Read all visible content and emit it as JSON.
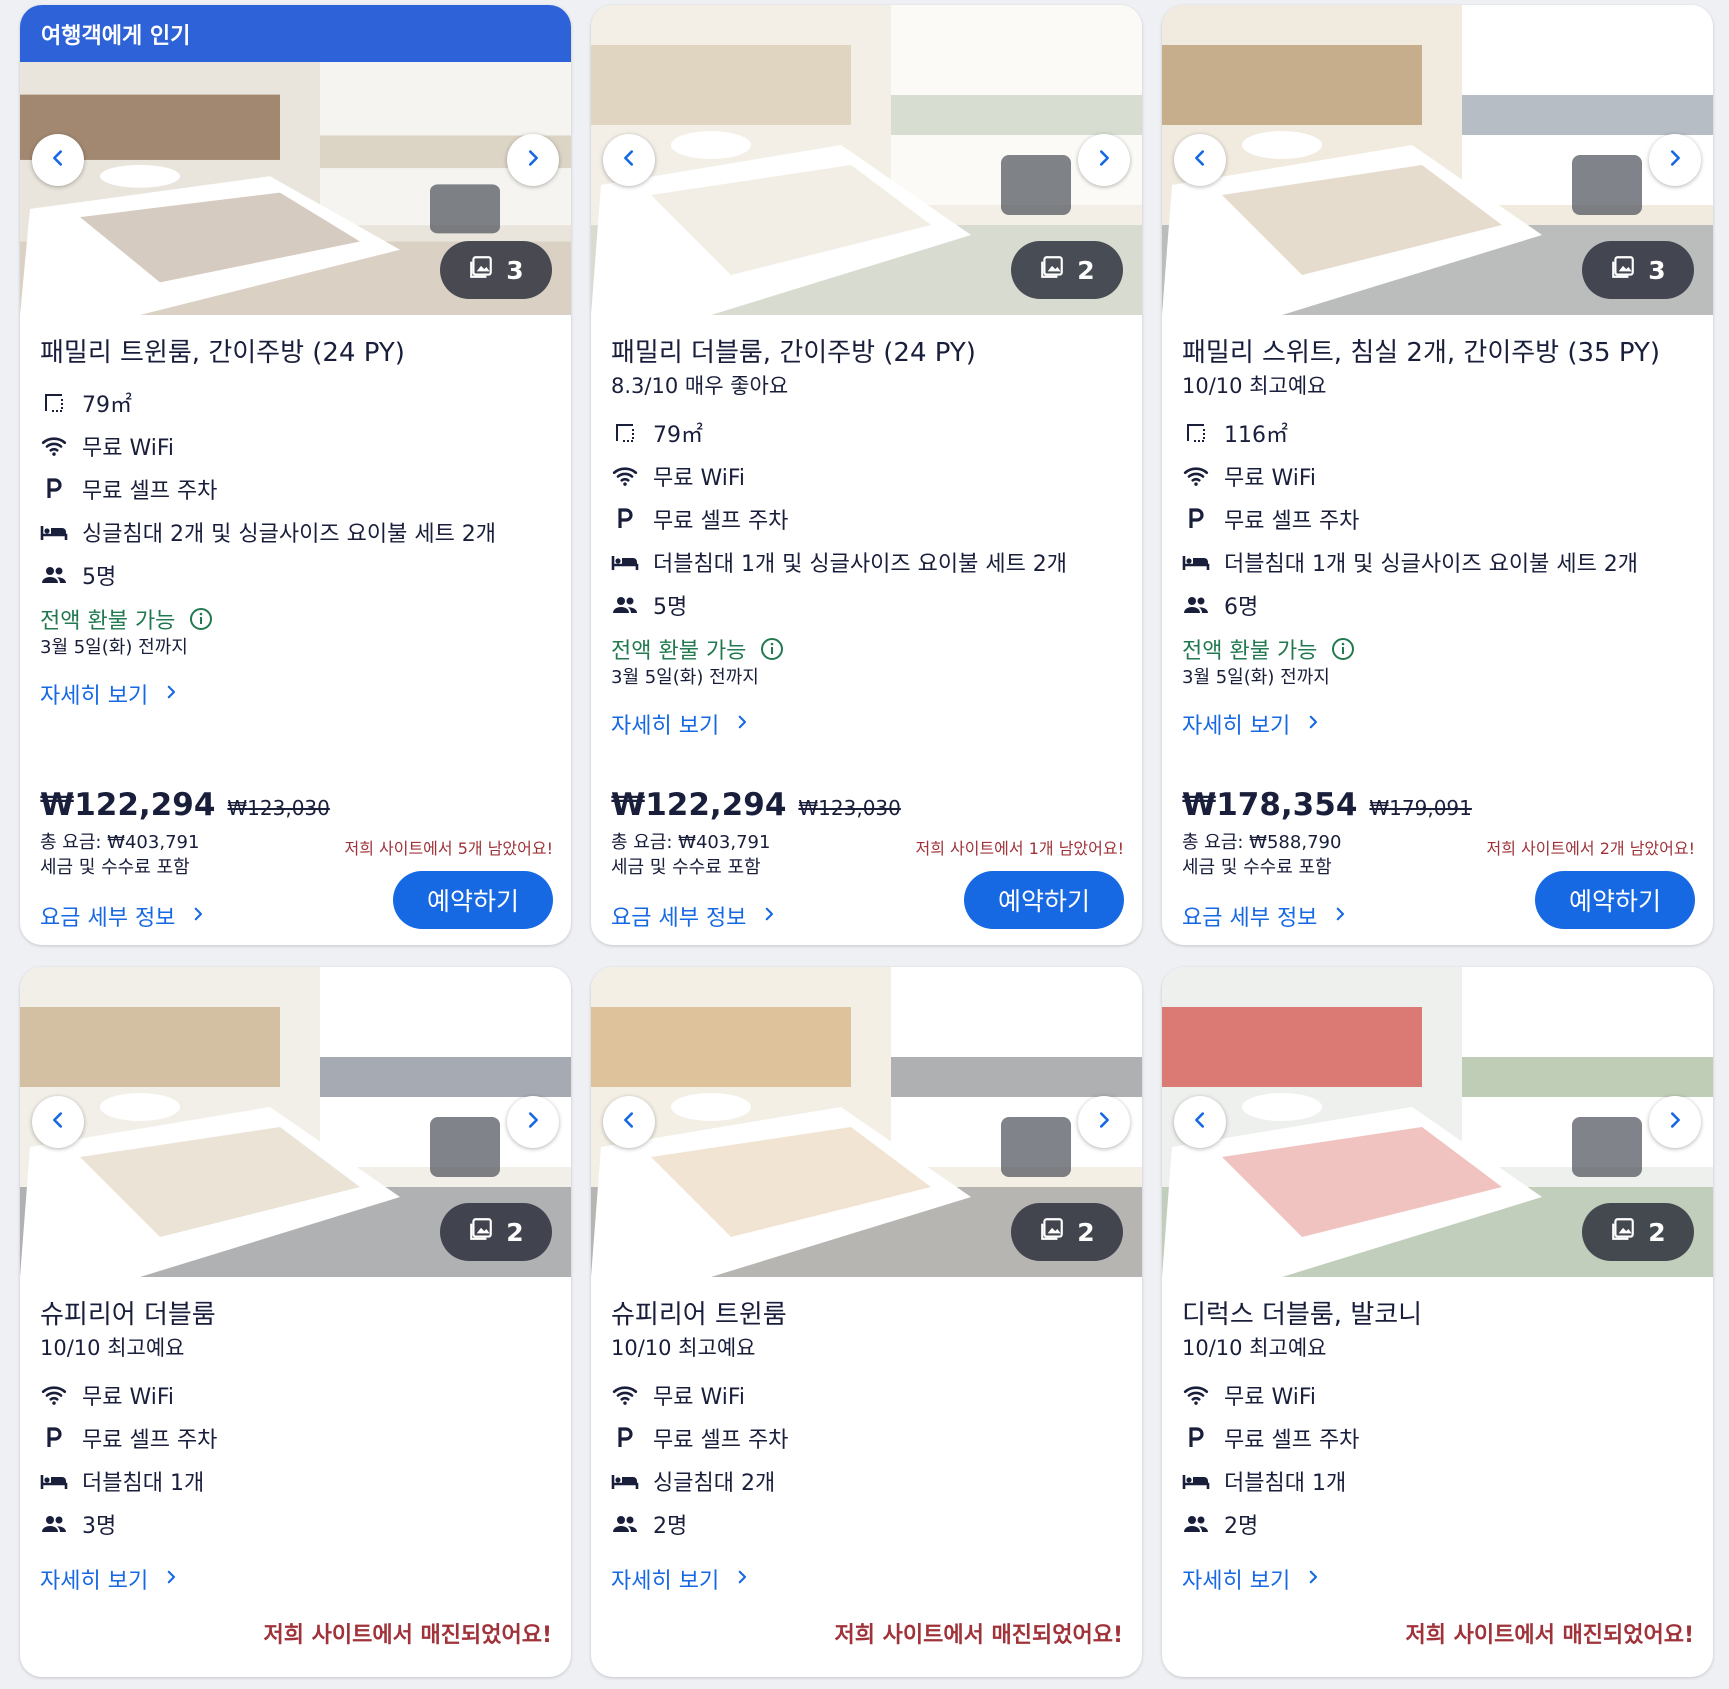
{
  "colors": {
    "accent": "#1668e3",
    "badge": "#2e62d9",
    "refund": "#227950",
    "alert": "#a0333a"
  },
  "cards": [
    {
      "badge": "여행객에게 인기",
      "photo_count": "3",
      "title": "패밀리 트윈룸, 간이주방 (24 PY)",
      "rating": "",
      "amenities": {
        "area": "79㎡",
        "wifi": "무료 WiFi",
        "parking": "무료 셀프 주차",
        "bed": "싱글침대 2개 및 싱글사이즈 요이불 세트 2개",
        "guests": "5명"
      },
      "refund": "전액 환불 가능",
      "refund_date": "3월 5일(화) 전까지",
      "details_link": "자세히 보기",
      "price": "₩122,294",
      "original_price": "₩123,030",
      "total": "총 요금: ₩403,791",
      "tax_note": "세금 및 수수료 포함",
      "remaining": "저희 사이트에서 5개 남았어요!",
      "fee_link": "요금 세부 정보",
      "reserve": "예약하기"
    },
    {
      "photo_count": "2",
      "title": "패밀리 더블룸, 간이주방 (24 PY)",
      "rating": "8.3/10 매우 좋아요",
      "amenities": {
        "area": "79㎡",
        "wifi": "무료 WiFi",
        "parking": "무료 셀프 주차",
        "bed": "더블침대 1개 및 싱글사이즈 요이불 세트 2개",
        "guests": "5명"
      },
      "refund": "전액 환불 가능",
      "refund_date": "3월 5일(화) 전까지",
      "details_link": "자세히 보기",
      "price": "₩122,294",
      "original_price": "₩123,030",
      "total": "총 요금: ₩403,791",
      "tax_note": "세금 및 수수료 포함",
      "remaining": "저희 사이트에서 1개 남았어요!",
      "fee_link": "요금 세부 정보",
      "reserve": "예약하기"
    },
    {
      "photo_count": "3",
      "title": "패밀리 스위트, 침실 2개, 간이주방 (35 PY)",
      "rating": "10/10 최고예요",
      "amenities": {
        "area": "116㎡",
        "wifi": "무료 WiFi",
        "parking": "무료 셀프 주차",
        "bed": "더블침대 1개 및 싱글사이즈 요이불 세트 2개",
        "guests": "6명"
      },
      "refund": "전액 환불 가능",
      "refund_date": "3월 5일(화) 전까지",
      "details_link": "자세히 보기",
      "price": "₩178,354",
      "original_price": "₩179,091",
      "total": "총 요금: ₩588,790",
      "tax_note": "세금 및 수수료 포함",
      "remaining": "저희 사이트에서 2개 남았어요!",
      "fee_link": "요금 세부 정보",
      "reserve": "예약하기"
    },
    {
      "photo_count": "2",
      "title": "슈피리어 더블룸",
      "rating": "10/10 최고예요",
      "amenities": {
        "wifi": "무료 WiFi",
        "parking": "무료 셀프 주차",
        "bed": "더블침대 1개",
        "guests": "3명"
      },
      "details_link": "자세히 보기",
      "soldout": "저희 사이트에서 매진되었어요!"
    },
    {
      "photo_count": "2",
      "title": "슈피리어 트윈룸",
      "rating": "10/10 최고예요",
      "amenities": {
        "wifi": "무료 WiFi",
        "parking": "무료 셀프 주차",
        "bed": "싱글침대 2개",
        "guests": "2명"
      },
      "details_link": "자세히 보기",
      "soldout": "저희 사이트에서 매진되었어요!"
    },
    {
      "photo_count": "2",
      "title": "디럭스 더블룸, 발코니",
      "rating": "10/10 최고예요",
      "amenities": {
        "wifi": "무료 WiFi",
        "parking": "무료 셀프 주차",
        "bed": "더블침대 1개",
        "guests": "2명"
      },
      "details_link": "자세히 보기",
      "soldout": "저희 사이트에서 매진되었어요!"
    }
  ],
  "icons": {
    "area": "area-icon",
    "wifi": "wifi-icon",
    "parking": "parking-icon",
    "bed": "bed-icon",
    "guests": "guests-icon",
    "info": "info-icon",
    "gallery": "image-gallery-icon",
    "prev": "chevron-left-icon",
    "next": "chevron-right-icon",
    "link": "chevron-right-icon"
  }
}
